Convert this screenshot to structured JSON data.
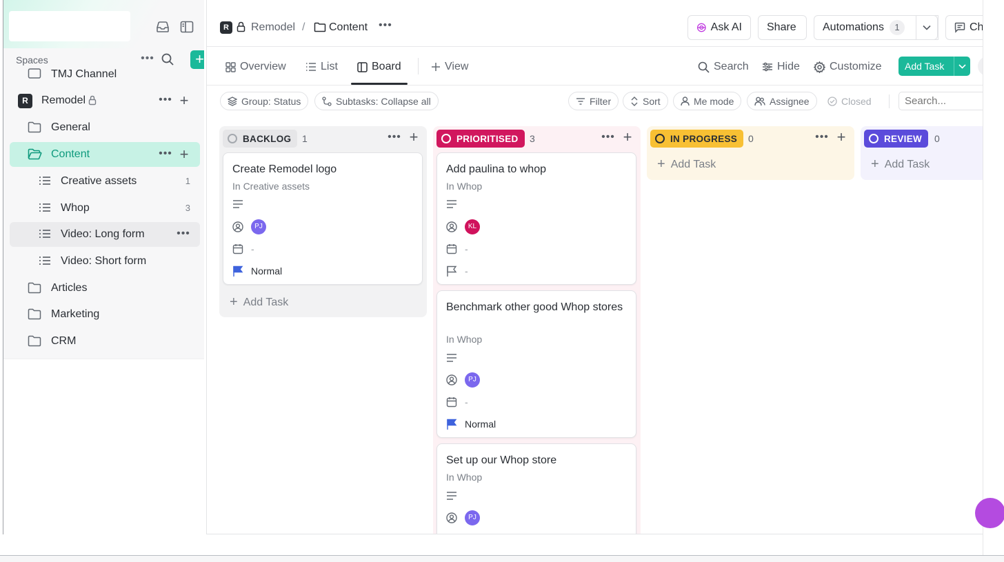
{
  "sidebar": {
    "spaces_label": "Spaces",
    "items": [
      {
        "label": "TMJ Channel"
      },
      {
        "label": "Remodel",
        "badge": "R"
      },
      {
        "label": "General"
      },
      {
        "label": "Content"
      },
      {
        "label": "Creative assets",
        "count": "1"
      },
      {
        "label": "Whop",
        "count": "3"
      },
      {
        "label": "Video: Long form"
      },
      {
        "label": "Video: Short form"
      },
      {
        "label": "Articles"
      },
      {
        "label": "Marketing"
      },
      {
        "label": "CRM"
      }
    ]
  },
  "breadcrumb": {
    "badge": "R",
    "space": "Remodel",
    "sep": "/",
    "current": "Content"
  },
  "topbar": {
    "ask_ai": "Ask AI",
    "share": "Share",
    "automations": "Automations",
    "automations_count": "1",
    "chat": "Chat"
  },
  "views": {
    "tabs": [
      "Overview",
      "List",
      "Board"
    ],
    "add_view": "View",
    "search": "Search",
    "hide": "Hide",
    "customize": "Customize",
    "add_task": "Add Task"
  },
  "filters": {
    "group": "Group: Status",
    "subtasks": "Subtasks: Collapse all",
    "filter": "Filter",
    "sort": "Sort",
    "me_mode": "Me mode",
    "assignee": "Assignee",
    "closed": "Closed",
    "search_placeholder": "Search..."
  },
  "board": {
    "add_task": "Add Task",
    "columns": [
      {
        "status": "BACKLOG",
        "count": "1",
        "color": "#a4a8ae",
        "bg": "#f2f2f3",
        "cards": [
          {
            "title": "Create Remodel logo",
            "list": "In Creative assets",
            "assignee": "PJ",
            "assignee_color": "#7b68ee",
            "date": "-",
            "priority": "Normal"
          }
        ]
      },
      {
        "status": "PRIORITISED",
        "count": "3",
        "color": "#e0245e",
        "bg": "#fdf1f4",
        "cards": [
          {
            "title": "Add paulina to whop",
            "list": "In Whop",
            "assignee": "KL",
            "assignee_color": "#d0125c",
            "date": "-",
            "priority": "-"
          },
          {
            "title": "Benchmark other good Whop stores",
            "list": "In Whop",
            "assignee": "PJ",
            "assignee_color": "#7b68ee",
            "date": "-",
            "priority": "Normal"
          },
          {
            "title": "Set up our Whop store",
            "list": "In Whop",
            "assignee": "PJ",
            "assignee_color": "#7b68ee"
          }
        ]
      },
      {
        "status": "IN PROGRESS",
        "count": "0",
        "color": "#f8c033",
        "bg": "#fdf6e6"
      },
      {
        "status": "REVIEW",
        "count": "0",
        "color": "#5b4bdb",
        "bg": "#f3f2fd"
      }
    ]
  },
  "colors": {
    "accent": "#1bb99a",
    "active_bg": "#c7f2e5",
    "priority_flag": "#3e63dd"
  }
}
